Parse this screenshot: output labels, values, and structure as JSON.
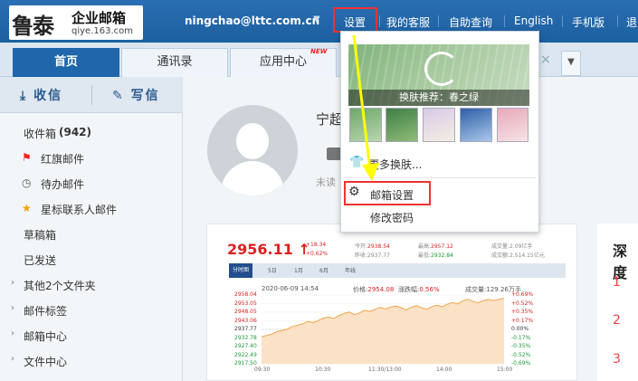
{
  "header": {
    "logo_glyph": "鲁泰",
    "logo_name": "企业邮箱",
    "logo_sub": "qiye.163.com",
    "user_email": "ningchao@lttc.com.cn",
    "links": [
      "设置",
      "我的客服",
      "自助查询",
      "English",
      "手机版",
      "退"
    ]
  },
  "tabs": {
    "items": [
      "首页",
      "通讯录",
      "应用中心"
    ],
    "new_badge": "NEW",
    "close": "×"
  },
  "sidebar": {
    "receive": "收信",
    "compose": "写信",
    "items": [
      {
        "label": "收件箱",
        "count": "(942)"
      },
      {
        "label": "红旗邮件"
      },
      {
        "label": "待办邮件"
      },
      {
        "label": "星标联系人邮件"
      },
      {
        "label": "草稿箱"
      },
      {
        "label": "已发送"
      },
      {
        "label": "其他2个文件夹"
      },
      {
        "label": "邮件标签"
      },
      {
        "label": "邮箱中心"
      },
      {
        "label": "文件中心"
      }
    ]
  },
  "main": {
    "greeting": "宁超",
    "unread": "未读"
  },
  "news": {
    "title": "深度",
    "ranks": [
      "1",
      "2",
      "3"
    ]
  },
  "dropdown": {
    "skin_caption": "换肤推荐：春之绿",
    "more_skins": "更多换肤...",
    "mail_settings": "邮箱设置",
    "change_password": "修改密码"
  },
  "stock": {
    "price": "2956.11 ↑",
    "change_abs": "+18.34",
    "change_pct": "+0.62%",
    "open_label": "今开:",
    "open_val": "2938.54",
    "prev_label": "昨收:",
    "prev_val": "2937.77",
    "high_label": "最高:",
    "high_val": "2957.12",
    "low_label": "最低:",
    "low_val": "2932.84",
    "vol_label": "成交量:",
    "vol_val": "2.09亿手",
    "amt_label": "成交额:",
    "amt_val": "2,514.15亿元",
    "tabs": [
      "分时图",
      "5日",
      "1月",
      "6月",
      "年线"
    ],
    "info_time": "2020-06-09 14:54",
    "info_price_label": "价格:",
    "info_price": "2954.08",
    "info_change_label": "涨跌幅:",
    "info_change": "0.56%",
    "info_vol_label": "成交量:",
    "info_vol": "129.26万手"
  },
  "chart_data": {
    "type": "area",
    "y_left_ticks": [
      "2958.04",
      "2953.05",
      "2948.05",
      "2943.06",
      "2937.77",
      "2932.78",
      "2927.40",
      "2922.49",
      "2917.50"
    ],
    "y_right_ticks": [
      "+0.69%",
      "+0.52%",
      "+0.35%",
      "+0.17%",
      "0.00%",
      "-0.17%",
      "-0.35%",
      "-0.52%",
      "-0.69%"
    ],
    "x_ticks": [
      "09:30",
      "10:30",
      "11:30/13:00",
      "14:00",
      "15:00"
    ],
    "ylim": [
      2917.5,
      2958.04
    ],
    "baseline": 2937.77,
    "values": [
      2933.5,
      2934.2,
      2935.0,
      2936.5,
      2937.2,
      2938.0,
      2939.5,
      2940.2,
      2941.0,
      2942.5,
      2941.8,
      2943.0,
      2944.5,
      2945.0,
      2944.2,
      2946.0,
      2947.2,
      2948.0,
      2946.5,
      2947.5,
      2949.0,
      2948.4,
      2949.6,
      2950.8,
      2949.8,
      2950.9,
      2951.5,
      2950.6,
      2949.3,
      2950.8,
      2951.8,
      2950.5,
      2949.6,
      2951.2,
      2952.0,
      2951.2,
      2952.6,
      2953.6,
      2952.8,
      2954.6,
      2955.6,
      2954.2,
      2953.5,
      2954.8,
      2955.4,
      2954.8,
      2955.5,
      2956.1
    ]
  },
  "colors": {
    "header_blue": "#1d5f9f",
    "highlight_red": "#e33",
    "arrow_yellow": "#ffff00",
    "stock_red": "#d22"
  }
}
